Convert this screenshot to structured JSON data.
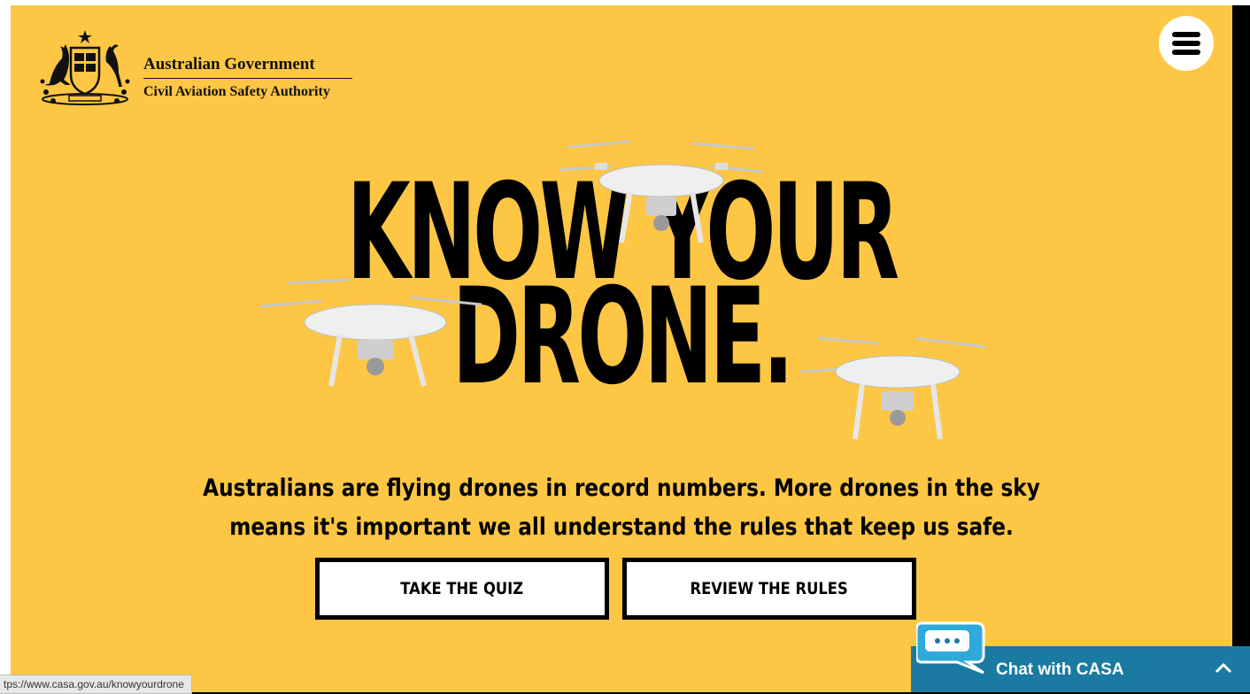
{
  "header": {
    "government": "Australian Government",
    "agency": "Civil Aviation Safety Authority",
    "menu_icon": "hamburger-menu-icon"
  },
  "hero": {
    "title_line1": "KNOW YOUR",
    "title_line2": "DRONE."
  },
  "intro": {
    "text": "Australians are flying drones in record numbers. More drones in the sky means it's important we all understand the rules that keep us safe."
  },
  "actions": {
    "quiz_label": "TAKE THE QUIZ",
    "rules_label": "REVIEW THE RULES"
  },
  "status_bar": {
    "url": "tps://www.casa.gov.au/knowyourdrone"
  },
  "chat": {
    "label": "Chat with CASA",
    "icon": "chat-bubble-icon",
    "toggle_icon": "chevron-up-icon"
  },
  "colors": {
    "background": "#fdc645",
    "text": "#000000",
    "chat_bar": "#1a7aa2",
    "chat_bubble": "#2fa9d9"
  }
}
